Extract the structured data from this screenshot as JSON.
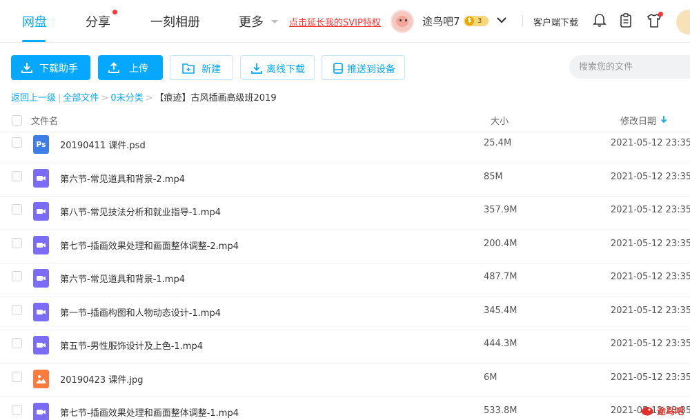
{
  "nav": {
    "tabs": [
      {
        "label": "网盘",
        "active": true
      },
      {
        "label": "分享",
        "active": false
      },
      {
        "label": "一刻相册",
        "active": false
      },
      {
        "label": "更多",
        "active": false
      }
    ],
    "promo": "点击延长我的SVIP特权",
    "username": "途鸟吧7",
    "vip_level": "3",
    "client_download": "客户端下载",
    "icons": [
      "bell-icon",
      "clipboard-icon",
      "tshirt-icon"
    ],
    "accent_color": "#06a7ff"
  },
  "toolbar": {
    "download_helper": "下载助手",
    "upload": "上传",
    "new": "新建",
    "offline_download": "离线下载",
    "push_device": "推送到设备",
    "search_placeholder": "搜索您的文件"
  },
  "breadcrumb": {
    "back": "返回上一级",
    "all": "全部文件",
    "uncategorized": "0未分类",
    "current": "【痕迹】古风插画高级班2019"
  },
  "table": {
    "headers": {
      "name": "文件名",
      "size": "大小",
      "date": "修改日期"
    },
    "rows": [
      {
        "type": "ps",
        "icon_label": "Ps",
        "name": "20190411 课件.psd",
        "size": "25.4M",
        "date": "2021-05-12 23:35"
      },
      {
        "type": "video",
        "name": "第六节-常见道具和背景-2.mp4",
        "size": "85M",
        "date": "2021-05-12 23:35"
      },
      {
        "type": "video",
        "name": "第八节-常见技法分析和就业指导-1.mp4",
        "size": "357.9M",
        "date": "2021-05-12 23:35"
      },
      {
        "type": "video",
        "name": "第七节-插画效果处理和画面整体调整-2.mp4",
        "size": "200.4M",
        "date": "2021-05-12 23:35"
      },
      {
        "type": "video",
        "name": "第六节-常见道具和背景-1.mp4",
        "size": "487.7M",
        "date": "2021-05-12 23:35"
      },
      {
        "type": "video",
        "name": "第一节-插画构图和人物动态设计-1.mp4",
        "size": "345.4M",
        "date": "2021-05-12 23:35"
      },
      {
        "type": "video",
        "name": "第五节-男性服饰设计及上色-1.mp4",
        "size": "444.3M",
        "date": "2021-05-12 23:35"
      },
      {
        "type": "image",
        "name": "20190423 课件.jpg",
        "size": "6M",
        "date": "2021-05-12 23:35"
      },
      {
        "type": "video",
        "name": "第七节-插画效果处理和画面整体调整-1.mp4",
        "size": "533.8M",
        "date": "2021-05-12 23:35"
      }
    ]
  },
  "watermark": "途鸟吧"
}
